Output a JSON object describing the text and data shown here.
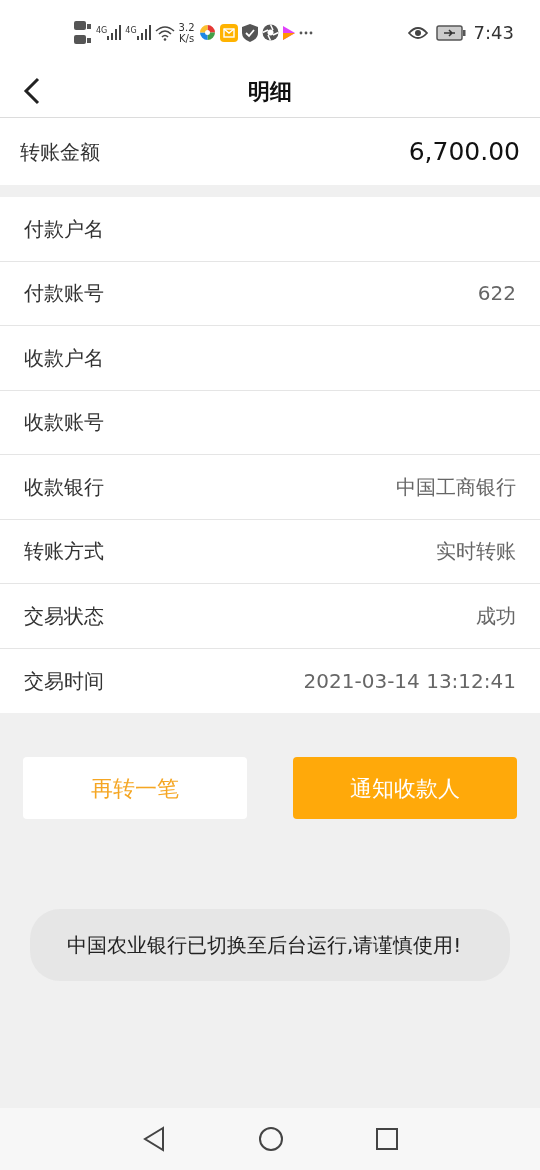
{
  "status_bar": {
    "network": [
      "4G",
      "4G"
    ],
    "speed": [
      "3.2",
      "K/s"
    ],
    "time": "7:43"
  },
  "header": {
    "title": "明细"
  },
  "amount": {
    "label": "转账金额",
    "value": "6,700.00"
  },
  "details": [
    {
      "label": "付款户名"
    },
    {
      "label": "付款账号",
      "value": "622"
    },
    {
      "label": "收款户名"
    },
    {
      "label": "收款账号"
    },
    {
      "label": "收款银行",
      "value": "中国工商银行"
    },
    {
      "label": "转账方式",
      "value": "实时转账"
    },
    {
      "label": "交易状态",
      "value": "成功"
    },
    {
      "label": "交易时间",
      "value": "2021-03-14 13:12:41"
    }
  ],
  "buttons": [
    {
      "label": "再转一笔",
      "kind": "secondary"
    },
    {
      "label": "通知收款人",
      "kind": "primary"
    }
  ],
  "toast": "中国农业银行已切换至后台运行,请谨慎使用!"
}
